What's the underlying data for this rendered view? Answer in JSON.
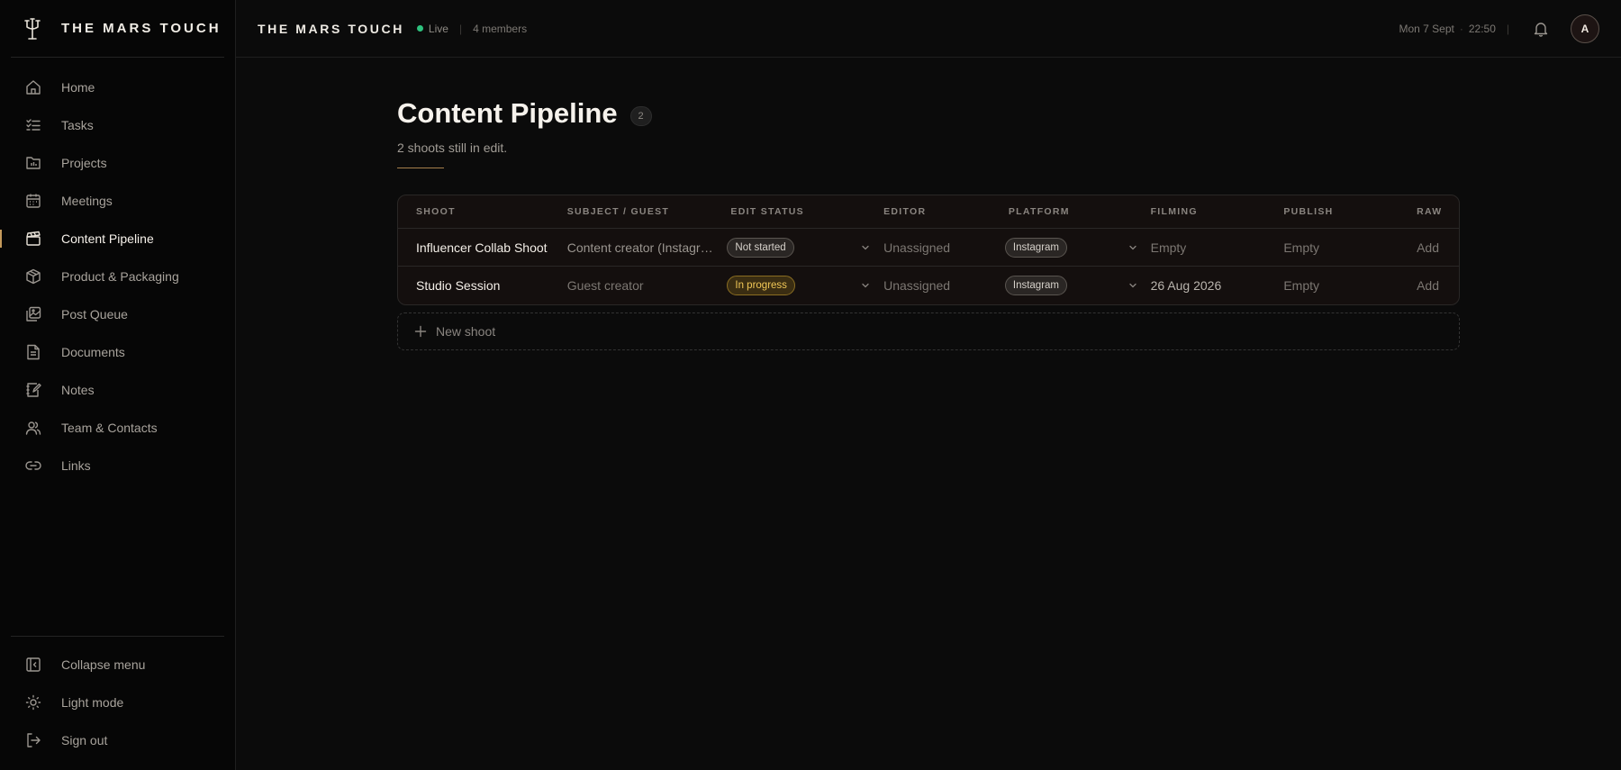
{
  "brand": {
    "name": "THE MARS TOUCH",
    "logo_icon": "trident-logo"
  },
  "sidebar": {
    "items": [
      {
        "label": "Home",
        "icon": "home-icon",
        "active": false
      },
      {
        "label": "Tasks",
        "icon": "tasks-icon",
        "active": false
      },
      {
        "label": "Projects",
        "icon": "folder-icon",
        "active": false
      },
      {
        "label": "Meetings",
        "icon": "calendar-icon",
        "active": false
      },
      {
        "label": "Content Pipeline",
        "icon": "clapperboard-icon",
        "active": true
      },
      {
        "label": "Product & Packaging",
        "icon": "box-icon",
        "active": false
      },
      {
        "label": "Post Queue",
        "icon": "images-icon",
        "active": false
      },
      {
        "label": "Documents",
        "icon": "document-icon",
        "active": false
      },
      {
        "label": "Notes",
        "icon": "notes-icon",
        "active": false
      },
      {
        "label": "Team & Contacts",
        "icon": "users-icon",
        "active": false
      },
      {
        "label": "Links",
        "icon": "link-icon",
        "active": false
      }
    ],
    "bottom": [
      {
        "label": "Collapse menu",
        "icon": "collapse-icon"
      },
      {
        "label": "Light mode",
        "icon": "sun-icon"
      },
      {
        "label": "Sign out",
        "icon": "sign-out-icon"
      }
    ]
  },
  "topbar": {
    "workspace": "THE MARS TOUCH",
    "live": "Live",
    "members": "4 members",
    "date": "Mon 7 Sept",
    "time": "22:50",
    "avatar": "A"
  },
  "page": {
    "title": "Content Pipeline",
    "count": "2",
    "subtitle": "2 shoots still in edit."
  },
  "table": {
    "headers": [
      "SHOOT",
      "SUBJECT / GUEST",
      "EDIT STATUS",
      "EDITOR",
      "PLATFORM",
      "FILMING",
      "PUBLISH",
      "RAW"
    ],
    "rows": [
      {
        "shoot": "Influencer Collab Shoot",
        "subject": "Content creator (Instagram)",
        "status": "Not started",
        "status_color": "#5a5550",
        "editor": "Unassigned",
        "platform": "Instagram",
        "filming": "Empty",
        "publish": "Empty",
        "raw": "Add"
      },
      {
        "shoot": "Studio Session",
        "subject": "Guest creator",
        "status": "In progress",
        "status_color": "#f0c756",
        "editor": "Unassigned",
        "platform": "Instagram",
        "filming": "26 Aug 2026",
        "publish": "Empty",
        "raw": "Add"
      }
    ]
  },
  "new_shoot": {
    "label": "New shoot"
  },
  "colors": {
    "accent": "#c49a5b",
    "live": "#2ec27e",
    "in_progress": "#f0c756",
    "background": "#0b0b0b"
  }
}
